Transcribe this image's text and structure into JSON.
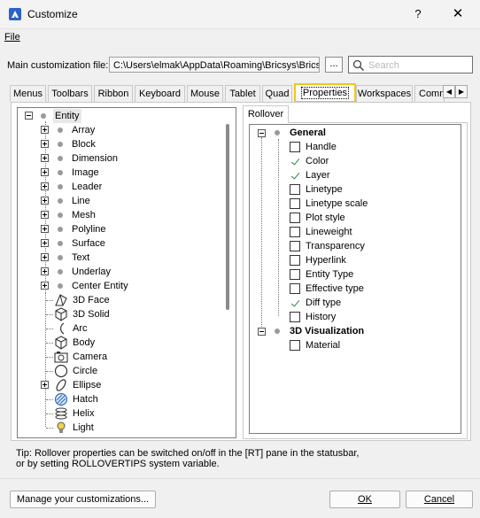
{
  "window": {
    "title": "Customize",
    "help_label": "?",
    "close_label": "✕",
    "icon": "bricscad-app-icon"
  },
  "menubar": {
    "file_label": "File"
  },
  "main_file": {
    "label": "Main customization file:",
    "value": "C:\\Users\\elmak\\AppData\\Roaming\\Bricsys\\BricsCAD",
    "browse_label": "...",
    "search_placeholder": "Search"
  },
  "tabs": [
    {
      "label": "Menus"
    },
    {
      "label": "Toolbars"
    },
    {
      "label": "Ribbon"
    },
    {
      "label": "Keyboard"
    },
    {
      "label": "Mouse"
    },
    {
      "label": "Tablet"
    },
    {
      "label": "Quad"
    },
    {
      "label": "Properties",
      "selected": true
    },
    {
      "label": "Workspaces"
    },
    {
      "label": "Comm"
    }
  ],
  "tab_scroll": {
    "left": "◀",
    "right": "▶"
  },
  "left_tree": {
    "root": "Entity",
    "groups": [
      "Array",
      "Block",
      "Dimension",
      "Image",
      "Leader",
      "Line",
      "Mesh",
      "Polyline",
      "Surface",
      "Text",
      "Underlay",
      "Center Entity"
    ],
    "items": [
      {
        "label": "3D Face",
        "icon": "3d-face-icon"
      },
      {
        "label": "3D Solid",
        "icon": "3d-solid-icon"
      },
      {
        "label": "Arc",
        "icon": "arc-icon"
      },
      {
        "label": "Body",
        "icon": "body-icon"
      },
      {
        "label": "Camera",
        "icon": "camera-icon"
      },
      {
        "label": "Circle",
        "icon": "circle-icon"
      },
      {
        "label": "Ellipse",
        "icon": "ellipse-icon",
        "expandable": true
      },
      {
        "label": "Hatch",
        "icon": "hatch-icon"
      },
      {
        "label": "Helix",
        "icon": "helix-icon"
      },
      {
        "label": "Light",
        "icon": "light-icon"
      }
    ]
  },
  "right": {
    "tab_label": "Rollover",
    "general_label": "General",
    "general_props": [
      {
        "label": "Handle",
        "checked": false
      },
      {
        "label": "Color",
        "checked": true
      },
      {
        "label": "Layer",
        "checked": true
      },
      {
        "label": "Linetype",
        "checked": false
      },
      {
        "label": "Linetype scale",
        "checked": false
      },
      {
        "label": "Plot style",
        "checked": false
      },
      {
        "label": "Lineweight",
        "checked": false
      },
      {
        "label": "Transparency",
        "checked": false
      },
      {
        "label": "Hyperlink",
        "checked": false
      },
      {
        "label": "Entity Type",
        "checked": false
      },
      {
        "label": "Effective type",
        "checked": false
      },
      {
        "label": "Diff type",
        "checked": true
      },
      {
        "label": "History",
        "checked": false
      }
    ],
    "viz_label": "3D Visualization",
    "viz_props": [
      {
        "label": "Material",
        "checked": false
      }
    ]
  },
  "tip": {
    "line1": "Tip: Rollover properties can be switched on/off in the [RT] pane in the statusbar,",
    "line2": "or by setting ROLLOVERTIPS system variable."
  },
  "buttons": {
    "manage": "Manage your customizations...",
    "ok": "OK",
    "cancel": "Cancel"
  }
}
